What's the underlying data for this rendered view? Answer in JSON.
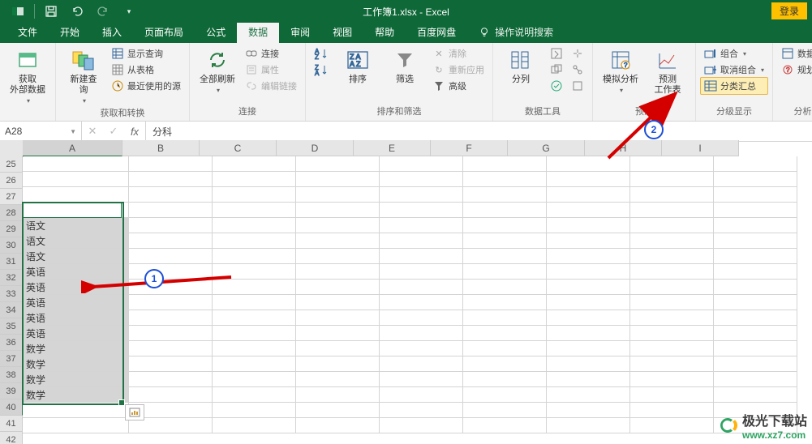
{
  "title": "工作簿1.xlsx - Excel",
  "login": "登录",
  "tabs": [
    "文件",
    "开始",
    "插入",
    "页面布局",
    "公式",
    "数据",
    "审阅",
    "视图",
    "帮助",
    "百度网盘"
  ],
  "active_tab": "数据",
  "tell_me": "操作说明搜索",
  "ribbon": {
    "g1": {
      "big": "获取\n外部数据"
    },
    "g2": {
      "big": "新建查\n询",
      "s1": "显示查询",
      "s2": "从表格",
      "s3": "最近使用的源",
      "label": "获取和转换"
    },
    "g3": {
      "big": "全部刷新",
      "s1": "连接",
      "s2": "属性",
      "s3": "编辑链接",
      "label": "连接"
    },
    "g4": {
      "b1": "排序",
      "b2": "筛选",
      "s1": "清除",
      "s2": "重新应用",
      "s3": "高级",
      "label": "排序和筛选"
    },
    "g5": {
      "big": "分列",
      "label": "数据工具"
    },
    "g6": {
      "b1": "模拟分析",
      "b2": "预测\n工作表",
      "label": "预测"
    },
    "g7": {
      "s1": "组合",
      "s2": "取消组合",
      "s3": "分类汇总",
      "label": "分级显示"
    },
    "g8": {
      "s1": "数据验",
      "s2": "规划",
      "label": "分析"
    }
  },
  "namebox": "A28",
  "formula": "分科",
  "columns": [
    "A",
    "B",
    "C",
    "D",
    "E",
    "F",
    "G",
    "H",
    "I"
  ],
  "colA_width": 122,
  "other_col_width": 94,
  "row_start": 25,
  "row_end": 42,
  "selection": {
    "first_row": 28,
    "last_row": 40,
    "col": "A"
  },
  "data_rows": {
    "28": "分科",
    "29": "语文",
    "30": "语文",
    "31": "语文",
    "32": "英语",
    "33": "英语",
    "34": "英语",
    "35": "英语",
    "36": "英语",
    "37": "数学",
    "38": "数学",
    "39": "数学",
    "40": "数学"
  },
  "badges": {
    "b1": "1",
    "b2": "2"
  },
  "watermark": {
    "t1": "极光下载站",
    "t2": "www.xz7.com"
  }
}
